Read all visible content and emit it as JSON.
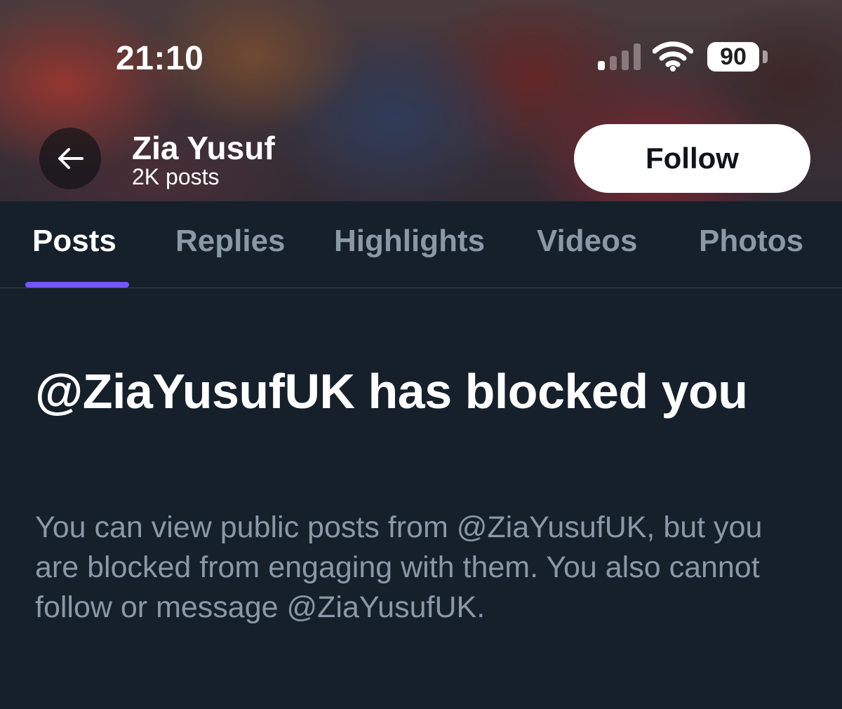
{
  "status_bar": {
    "time": "21:10",
    "battery": "90",
    "icons": [
      "cellular-signal-icon",
      "wifi-icon",
      "battery-icon"
    ]
  },
  "header": {
    "back_icon": "arrow-left-icon",
    "name": "Zia Yusuf",
    "post_count": "2K posts",
    "follow_label": "Follow"
  },
  "tabs": [
    {
      "label": "Posts",
      "active": true
    },
    {
      "label": "Replies",
      "active": false
    },
    {
      "label": "Highlights",
      "active": false
    },
    {
      "label": "Videos",
      "active": false
    },
    {
      "label": "Photos",
      "active": false
    }
  ],
  "message": {
    "title": "@ZiaYusufUK has blocked you",
    "body": "You can view public posts from @ZiaYusufUK, but you are blocked from engaging with them. You also cannot follow or message @ZiaYusufUK."
  },
  "colors": {
    "background": "#15202b",
    "tab_indicator": "#7856ff",
    "secondary_text": "#8b98a5",
    "divider": "#38444d"
  }
}
